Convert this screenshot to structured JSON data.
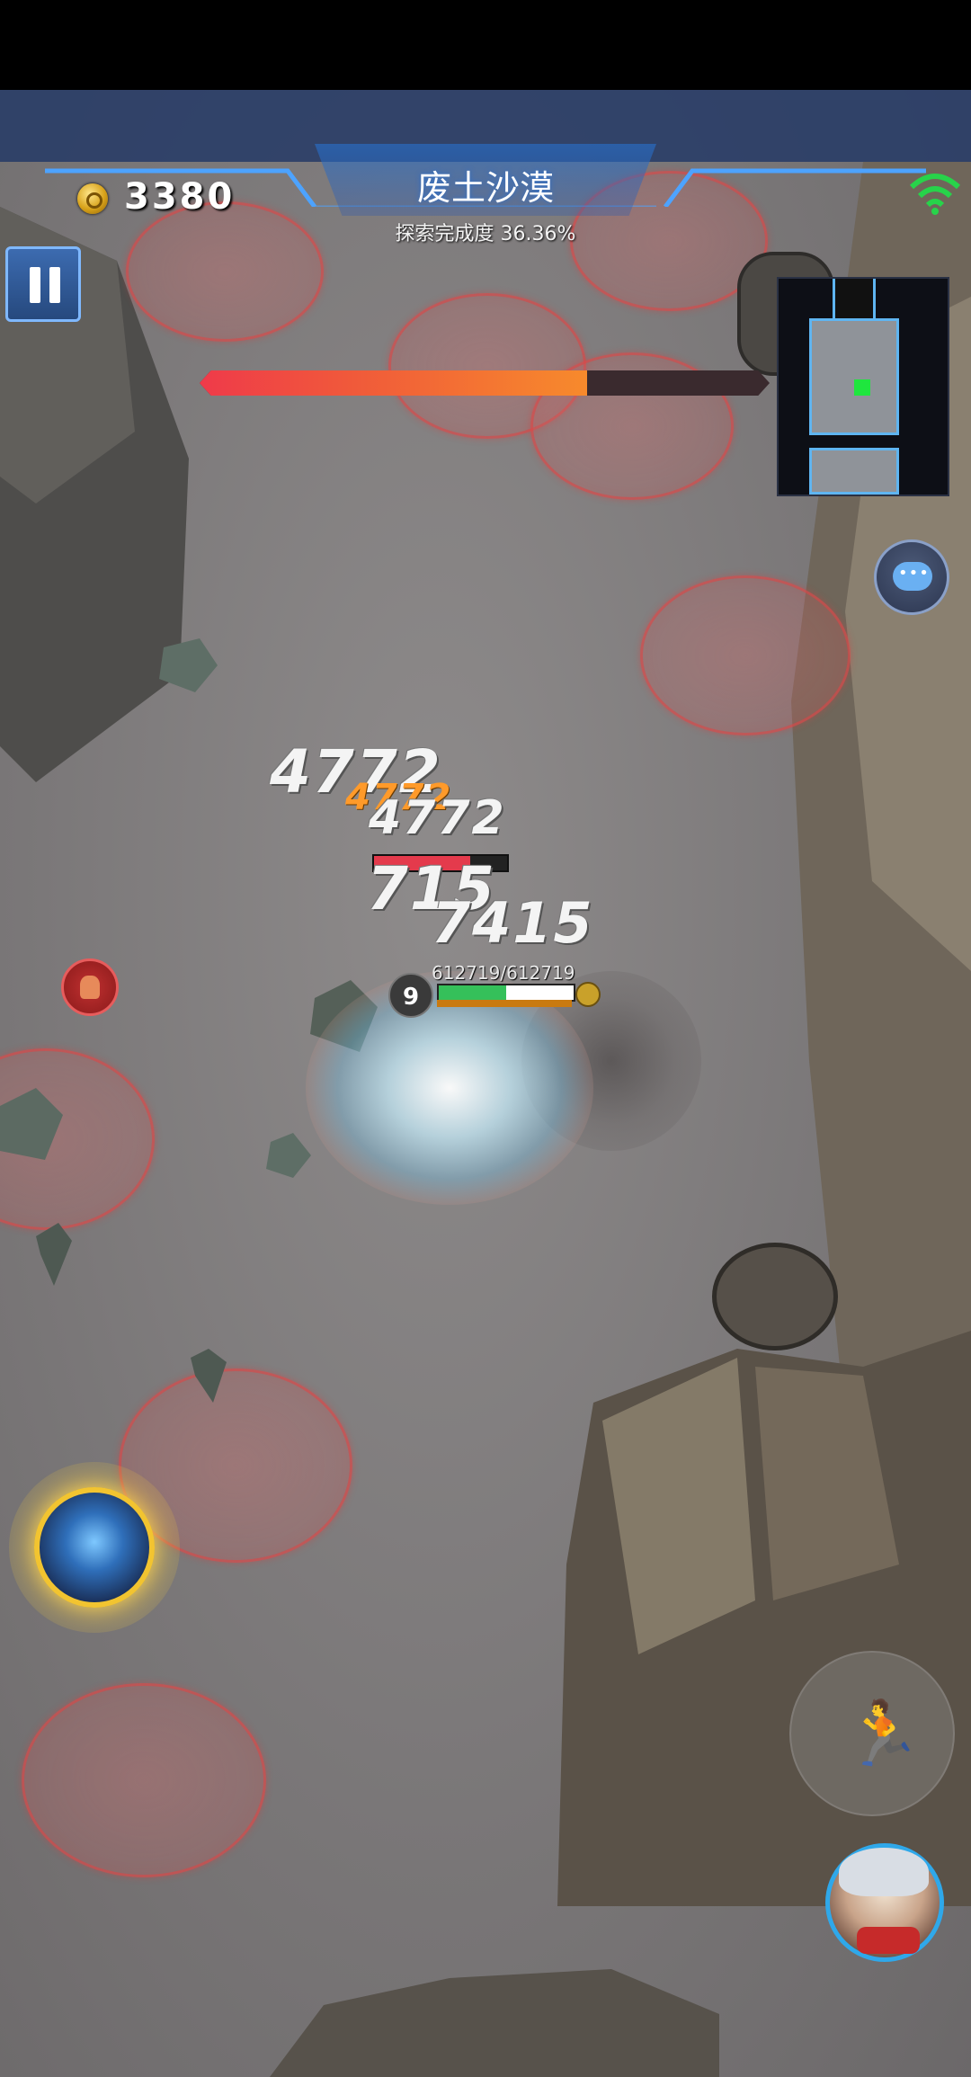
{
  "hud": {
    "gold": "3380",
    "area_name": "废土沙漠",
    "exploration": "探索完成度 36.36%",
    "boss_hp_fraction": 0.68
  },
  "combat": {
    "damage_numbers": [
      "4772",
      "4772",
      "715",
      "715",
      "7415"
    ],
    "crit_numbers": [
      "4772"
    ],
    "enemy_hp_fraction": 0.72
  },
  "player": {
    "level": "9",
    "hp_text": "612719/612719",
    "hp_fraction": 0.5
  },
  "icons": {
    "pause": "pause-icon",
    "wifi": "wifi-icon",
    "chat": "chat-icon",
    "skill": "slash-skill-icon",
    "dash": "dash-icon",
    "portrait": "hero-portrait"
  },
  "colors": {
    "boss_bar": "#f05a3a",
    "danger_zone": "#dd4a4a",
    "minimap_player": "#1fe63e",
    "skill_ring": "#f2c430"
  }
}
